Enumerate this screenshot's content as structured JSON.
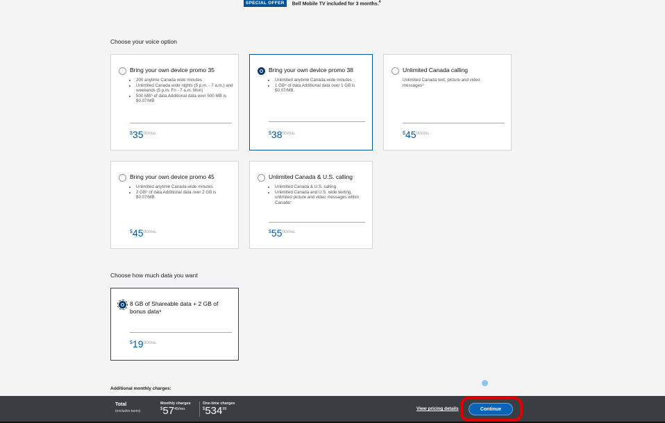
{
  "promo": {
    "badge": "SPECIAL OFFER",
    "text": "Bell Mobile TV included for 3 months.",
    "sup": "4"
  },
  "voice": {
    "title": "Choose your voice option",
    "plans": [
      {
        "title": "Bring your own device promo 35",
        "bullets": [
          "200 anytime Canada wide minutes",
          "Unlimited Canada wide nights (5 p.m. - 7 a.m.) and weekends (5 p.m. Fri - 7 a.m. Mon)",
          "500 MB⁵ of data Additional data over 500 MB is $0.07/MB"
        ],
        "cur": "$",
        "amount": "35",
        "cents": "00/mo.",
        "selected": false
      },
      {
        "title": "Bring your own device promo 38",
        "bullets": [
          "Unlimited anytime Canada-wide minutes",
          "1 GB⁵ of data Additional data over 1 GB is $0.07/MB."
        ],
        "cur": "$",
        "amount": "38",
        "cents": "00/mo.",
        "selected": true
      },
      {
        "title": "Unlimited Canada calling",
        "description": "Unlimited Canada text, picture and video messages⁶",
        "cur": "$",
        "amount": "45",
        "cents": "00/mo.",
        "selected": false
      },
      {
        "title": "Bring your own device promo 45",
        "bullets": [
          "Unlimited anytime Canada-wide minutes",
          "2 GB⁵ of data Additional data over 2 GB is $0.07/MB."
        ],
        "cur": "$",
        "amount": "45",
        "cents": "00/mo.",
        "selected": false
      },
      {
        "title": "Unlimited Canada & U.S. calling",
        "bullets": [
          "Unlimited Canada & U.S. calling",
          "Unlimited Canada and U.S. wide texting, unlimited picture and video messages within Canada⁷"
        ],
        "cur": "$",
        "amount": "55",
        "cents": "00/mo.",
        "selected": false
      }
    ]
  },
  "data": {
    "title": "Choose how much data you want",
    "option": {
      "title": "8 GB of Shareable data + 2 GB of bonus data⁸",
      "cur": "$",
      "amount": "19",
      "cents": "00/mo.",
      "selected": true
    }
  },
  "additional": {
    "label": "Additional monthly charges:"
  },
  "footer": {
    "total_label": "Total",
    "total_sub": "(excludes taxes)",
    "monthly_label": "Monthly charges",
    "monthly_cur": "$",
    "monthly_amount": "57",
    "monthly_cents": "45/mo.",
    "onetime_label": "One-time charges",
    "onetime_cur": "$",
    "onetime_amount": "534",
    "onetime_cents": "99",
    "pricing_link": "View pricing details",
    "continue": "Continue"
  },
  "colors": {
    "accent": "#00549a",
    "footer_bg": "#3a3d42",
    "button": "#0b63b5",
    "highlight": "#e00000"
  }
}
